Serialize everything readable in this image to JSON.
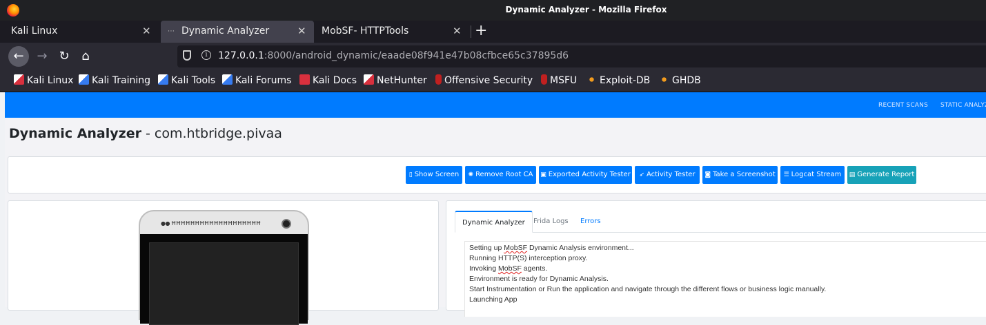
{
  "window": {
    "title": "Dynamic Analyzer - Mozilla Firefox"
  },
  "tabs": [
    {
      "label": "Kali Linux",
      "active": false
    },
    {
      "label": "Dynamic Analyzer",
      "active": true
    },
    {
      "label": "MobSF- HTTPTools",
      "active": false
    }
  ],
  "url": {
    "host": "127.0.0.1",
    "rest": ":8000/android_dynamic/eaade08f941e47b08cfbce65c37895d6"
  },
  "bookmarks": [
    {
      "label": "Kali Linux",
      "icon": "kali-icon"
    },
    {
      "label": "Kali Training",
      "icon": "kali-training-icon"
    },
    {
      "label": "Kali Tools",
      "icon": "kali-tools-icon"
    },
    {
      "label": "Kali Forums",
      "icon": "kali-forums-icon"
    },
    {
      "label": "Kali Docs",
      "icon": "kali-docs-icon"
    },
    {
      "label": "NetHunter",
      "icon": "nethunter-icon"
    },
    {
      "label": "Offensive Security",
      "icon": "offsec-icon"
    },
    {
      "label": "MSFU",
      "icon": "msfu-icon"
    },
    {
      "label": "Exploit-DB",
      "icon": "exploit-db-icon"
    },
    {
      "label": "GHDB",
      "icon": "ghdb-icon"
    }
  ],
  "topnav": {
    "recent_scans": "RECENT SCANS",
    "static_analyzer": "STATIC ANALYZ"
  },
  "heading": {
    "title": "Dynamic Analyzer",
    "separator": " - ",
    "package": "com.htbridge.pivaa"
  },
  "actions": [
    {
      "label": "Show Screen",
      "icon": "mobile-icon"
    },
    {
      "label": "Remove Root CA",
      "icon": "cog-icon"
    },
    {
      "label": "Exported Activity Tester",
      "icon": "id-card-icon"
    },
    {
      "label": "Activity Tester",
      "icon": "rocket-icon"
    },
    {
      "label": "Take a Screenshot",
      "icon": "camera-icon"
    },
    {
      "label": "Logcat Stream",
      "icon": "bars-icon"
    },
    {
      "label": "Generate Report",
      "icon": "file-icon"
    }
  ],
  "console_tabs": {
    "dynamic": "Dynamic Analyzer",
    "frida": "Frida Logs",
    "errors": "Errors"
  },
  "log": {
    "l1a": "Setting up ",
    "l1b": "MobSF",
    "l1c": " Dynamic Analysis environment...",
    "l2": "Running HTTP(S) interception proxy.",
    "l3a": "Invoking ",
    "l3b": "MobSF",
    "l3c": " agents.",
    "l4": "Environment is ready for Dynamic Analysis.",
    "l5": "Start Instrumentation or Run the application and navigate through the different flows or business logic manually.",
    "l6": "Launching App"
  },
  "colors": {
    "primary": "#007bff",
    "teal": "#17a2b8",
    "chrome_dark": "#2b2a33"
  }
}
